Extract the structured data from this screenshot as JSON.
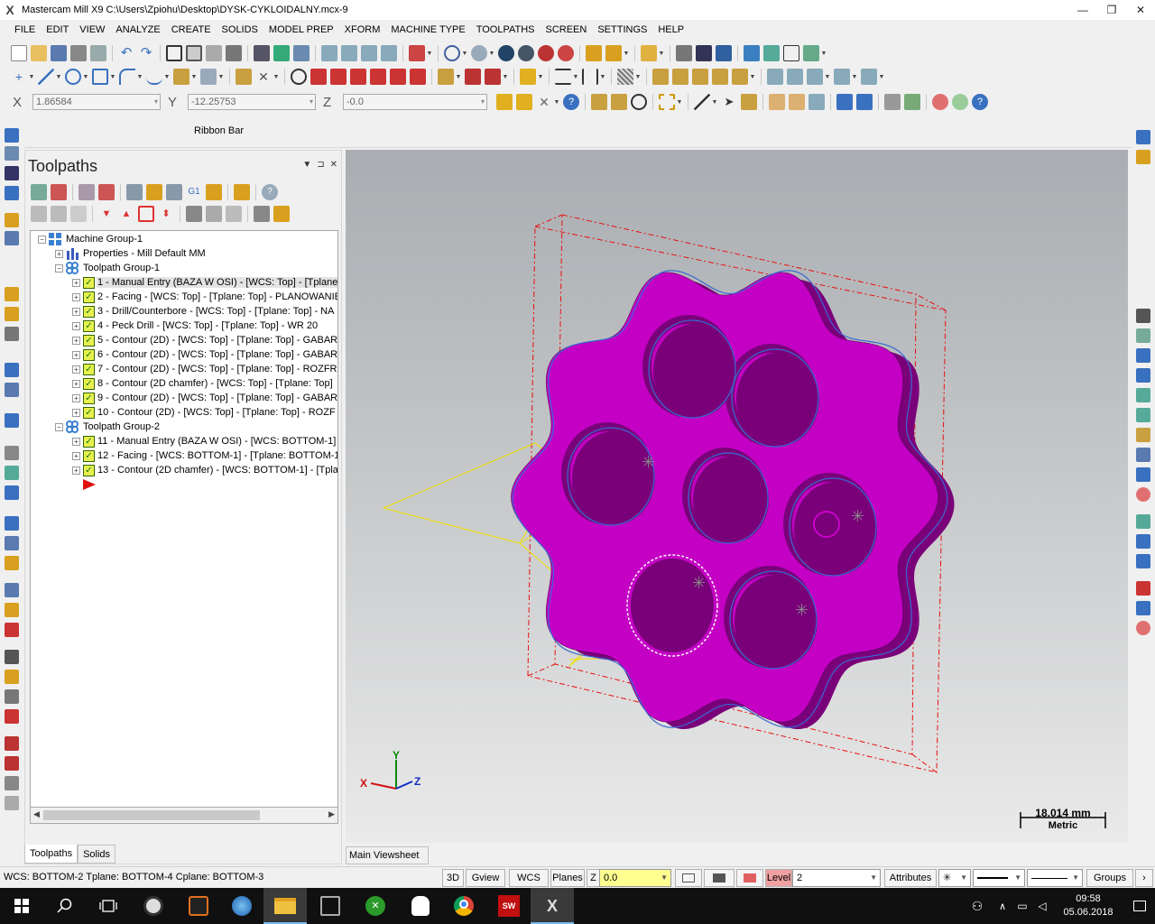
{
  "window": {
    "title": "Mastercam Mill X9  C:\\Users\\Zpiohu\\Desktop\\DYSK-CYKLOIDALNY.mcx-9",
    "logo": "X",
    "minimize": "—",
    "restore": "❐",
    "close": "✕"
  },
  "menu": [
    "FILE",
    "EDIT",
    "VIEW",
    "ANALYZE",
    "CREATE",
    "SOLIDS",
    "MODEL PREP",
    "XFORM",
    "MACHINE TYPE",
    "TOOLPATHS",
    "SCREEN",
    "SETTINGS",
    "HELP"
  ],
  "coords": {
    "x_label": "X",
    "x_value": "1.86584",
    "y_label": "Y",
    "y_value": "-12.25753",
    "z_label": "Z",
    "z_value": "-0.0"
  },
  "ribbon_bar": {
    "label": "Ribbon Bar"
  },
  "toolpaths_panel": {
    "title": "Toolpaths",
    "dropdown": "▼",
    "pin": "⊐",
    "close": "✕",
    "tree": [
      {
        "level": 0,
        "icon": "machine-group-icon",
        "text": "Machine Group-1",
        "checkbox": false,
        "expander": "−"
      },
      {
        "level": 1,
        "icon": "properties-icon",
        "text": "Properties - Mill Default MM",
        "checkbox": false,
        "expander": "+"
      },
      {
        "level": 1,
        "icon": "toolpath-group-icon",
        "text": "Toolpath Group-1",
        "checkbox": false,
        "expander": "−"
      },
      {
        "level": 2,
        "icon": "",
        "text": "1 - Manual Entry (BAZA W OSI) - [WCS: Top] - [Tplane",
        "checkbox": true,
        "expander": "+",
        "selected": true
      },
      {
        "level": 2,
        "icon": "",
        "text": "2 - Facing - [WCS: Top] - [Tplane: Top] - PLANOWANIE",
        "checkbox": true,
        "expander": "+"
      },
      {
        "level": 2,
        "icon": "",
        "text": "3 - Drill/Counterbore - [WCS: Top] - [Tplane: Top] - NA",
        "checkbox": true,
        "expander": "+"
      },
      {
        "level": 2,
        "icon": "",
        "text": "4 - Peck Drill - [WCS: Top] - [Tplane: Top] - WR 20",
        "checkbox": true,
        "expander": "+"
      },
      {
        "level": 2,
        "icon": "",
        "text": "5 - Contour (2D) - [WCS: Top] - [Tplane: Top] - GABAR",
        "checkbox": true,
        "expander": "+"
      },
      {
        "level": 2,
        "icon": "",
        "text": "6 - Contour (2D) - [WCS: Top] - [Tplane: Top] - GABAR",
        "checkbox": true,
        "expander": "+"
      },
      {
        "level": 2,
        "icon": "",
        "text": "7 - Contour (2D) - [WCS: Top] - [Tplane: Top] - ROZFR",
        "checkbox": true,
        "expander": "+"
      },
      {
        "level": 2,
        "icon": "",
        "text": "8 - Contour (2D chamfer) - [WCS: Top] - [Tplane: Top]",
        "checkbox": true,
        "expander": "+"
      },
      {
        "level": 2,
        "icon": "",
        "text": "9 - Contour (2D) - [WCS: Top] - [Tplane: Top] - GABAR",
        "checkbox": true,
        "expander": "+"
      },
      {
        "level": 2,
        "icon": "",
        "text": "10 - Contour (2D) - [WCS: Top] - [Tplane: Top] - ROZF",
        "checkbox": true,
        "expander": "+"
      },
      {
        "level": 1,
        "icon": "toolpath-group-icon",
        "text": "Toolpath Group-2",
        "checkbox": false,
        "expander": "−"
      },
      {
        "level": 2,
        "icon": "",
        "text": "11 - Manual Entry (BAZA W OSI) - [WCS: BOTTOM-1] -",
        "checkbox": true,
        "expander": "+"
      },
      {
        "level": 2,
        "icon": "",
        "text": "12 - Facing - [WCS: BOTTOM-1] - [Tplane: BOTTOM-1]",
        "checkbox": true,
        "expander": "+"
      },
      {
        "level": 2,
        "icon": "",
        "text": "13 - Contour (2D chamfer) - [WCS: BOTTOM-1] - [Tplar",
        "checkbox": true,
        "expander": "+"
      },
      {
        "level": 2,
        "icon": "insert-arrow-icon",
        "text": "",
        "checkbox": false,
        "expander": ""
      }
    ],
    "tabs": [
      {
        "label": "Toolpaths",
        "active": true
      },
      {
        "label": "Solids",
        "active": false
      }
    ]
  },
  "viewport": {
    "scale_value": "18.014 mm",
    "scale_unit": "Metric",
    "axis_y": "Y",
    "axis_x": "X",
    "axis_z": "Z",
    "sheet_tab": "Main Viewsheet",
    "part_color": "#c400c4",
    "part_shadow": "#7a007a",
    "stock_color": "#e81010",
    "toolpath_color": "#f0e000"
  },
  "status": {
    "text": "WCS: BOTTOM-2  Tplane: BOTTOM-4  Cplane: BOTTOM-3",
    "btn_3d": "3D",
    "btn_gview": "Gview",
    "btn_wcs": "WCS",
    "btn_planes": "Planes",
    "z_label": "Z",
    "z_value": "0.0",
    "level_label": "Level",
    "level_value": "2",
    "btn_attributes": "Attributes",
    "btn_groups": "Groups"
  },
  "taskbar": {
    "time": "09:58",
    "date": "05.06.2018"
  }
}
